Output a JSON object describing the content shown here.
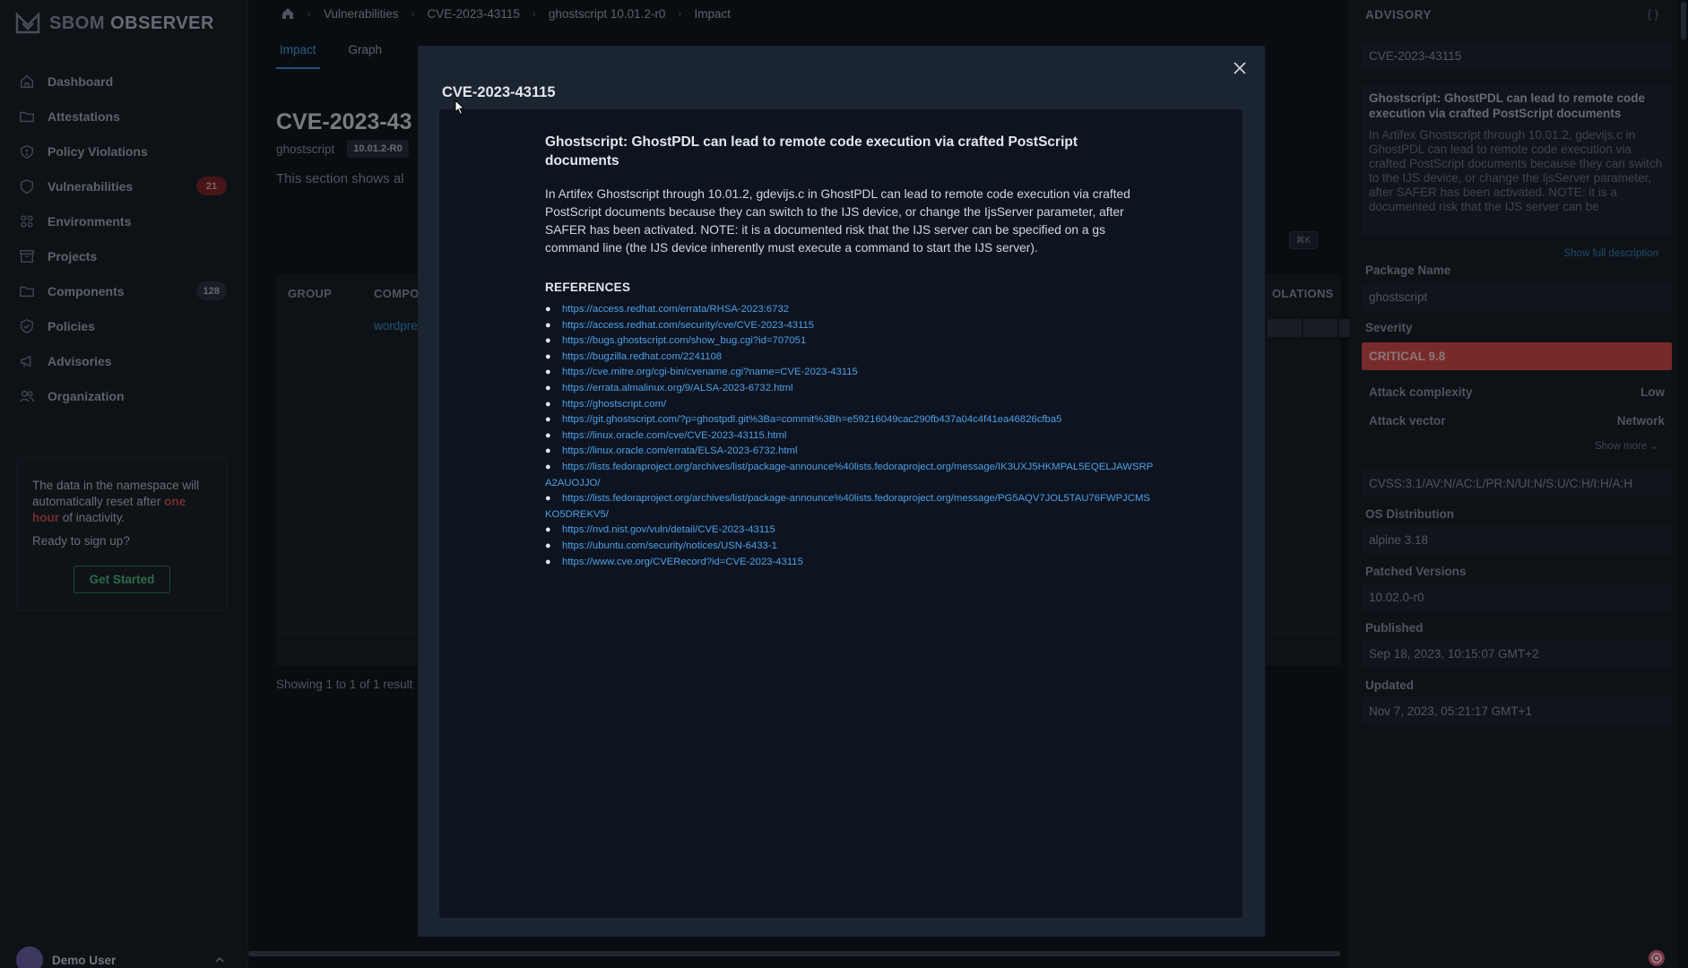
{
  "app": {
    "logo_light": "SBOM",
    "logo_bold": "OBSERVER"
  },
  "sidebar": {
    "items": [
      {
        "label": "Dashboard",
        "icon": "home-icon"
      },
      {
        "label": "Attestations",
        "icon": "folder-icon"
      },
      {
        "label": "Policy Violations",
        "icon": "alert-icon"
      },
      {
        "label": "Vulnerabilities",
        "icon": "shield-icon",
        "badge": "21"
      },
      {
        "label": "Environments",
        "icon": "grid-icon"
      },
      {
        "label": "Projects",
        "icon": "archive-icon"
      },
      {
        "label": "Components",
        "icon": "folder-icon",
        "badge": "128"
      },
      {
        "label": "Policies",
        "icon": "shield-check-icon"
      },
      {
        "label": "Advisories",
        "icon": "megaphone-icon"
      },
      {
        "label": "Organization",
        "icon": "users-icon"
      }
    ],
    "notice": {
      "text_1": "The data in the namespace will automatically reset after ",
      "highlight": "one hour",
      "text_2": " of inactivity.",
      "question": "Ready to sign up?",
      "button": "Get Started"
    },
    "user": "Demo User"
  },
  "breadcrumb": [
    "Vulnerabilities",
    "CVE-2023-43115",
    "ghostscript 10.01.2-r0",
    "Impact"
  ],
  "tabs": [
    "Impact",
    "Graph"
  ],
  "main": {
    "title": "CVE-2023-43",
    "package": "ghostscript",
    "version": "10.01.2-R0",
    "description": "This section shows al",
    "table": {
      "headers": [
        "GROUP",
        "COMPO",
        "OLATIONS"
      ],
      "cell": "wordpre",
      "kbd": "⌘K"
    },
    "showing": "Showing 1 to 1 of 1 result"
  },
  "advisory_panel": {
    "title": "ADVISORY",
    "braces": "{ }",
    "id": "CVE-2023-43115",
    "desc_title": "Ghostscript: GhostPDL can lead to remote code execution via crafted PostScript documents",
    "desc_text": "In Artifex Ghostscript through 10.01.2, gdevijs.c in GhostPDL can lead to remote code execution via crafted PostScript documents because they can switch to the IJS device, or change the IjsServer parameter, after SAFER has been activated. NOTE: it is a documented risk that the IJS server can be",
    "show_full": "Show full description",
    "package_label": "Package Name",
    "package_value": "ghostscript",
    "severity_label": "Severity",
    "severity_value": "CRITICAL 9.8",
    "severity_color": "#d84545",
    "attack_complexity_label": "Attack complexity",
    "attack_complexity_value": "Low",
    "attack_vector_label": "Attack vector",
    "attack_vector_value": "Network",
    "show_more": "Show more",
    "cvss": "CVSS:3.1/AV:N/AC:L/PR:N/UI:N/S:U/C:H/I:H/A:H",
    "os_label": "OS Distribution",
    "os_value": "alpine 3.18",
    "patched_label": "Patched Versions",
    "patched_value": "10.02.0-r0",
    "published_label": "Published",
    "published_value": "Sep 18, 2023, 10:15:07 GMT+2",
    "updated_label": "Updated",
    "updated_value": "Nov 7, 2023, 05:21:17 GMT+1"
  },
  "modal": {
    "title": "CVE-2023-43115",
    "advisory_title": "Ghostscript: GhostPDL can lead to remote code execution via crafted PostScript documents",
    "advisory_text": "In Artifex Ghostscript through 10.01.2, gdevijs.c in GhostPDL can lead to remote code execution via crafted PostScript documents because they can switch to the IJS device, or change the IjsServer parameter, after SAFER has been activated. NOTE: it is a documented risk that the IJS server can be specified on a gs command line (the IJS device inherently must execute a command to start the IJS server).",
    "references_heading": "REFERENCES",
    "references": [
      "https://access.redhat.com/errata/RHSA-2023:6732",
      "https://access.redhat.com/security/cve/CVE-2023-43115",
      "https://bugs.ghostscript.com/show_bug.cgi?id=707051",
      "https://bugzilla.redhat.com/2241108",
      "https://cve.mitre.org/cgi-bin/cvename.cgi?name=CVE-2023-43115",
      "https://errata.almalinux.org/9/ALSA-2023-6732.html",
      "https://ghostscript.com/",
      "https://git.ghostscript.com/?p=ghostpdl.git%3Ba=commit%3Bh=e59216049cac290fb437a04c4f41ea46826cfba5",
      "https://linux.oracle.com/cve/CVE-2023-43115.html",
      "https://linux.oracle.com/errata/ELSA-2023-6732.html",
      "https://lists.fedoraproject.org/archives/list/package-announce%40lists.fedoraproject.org/message/IK3UXJ5HKMPAL5EQELJAWSRPA2AUOJJO/",
      "https://lists.fedoraproject.org/archives/list/package-announce%40lists.fedoraproject.org/message/PG5AQV7JOL5TAU76FWPJCMSKO5DREKV5/",
      "https://nvd.nist.gov/vuln/detail/CVE-2023-43115",
      "https://ubuntu.com/security/notices/USN-6433-1",
      "https://www.cve.org/CVERecord?id=CVE-2023-43115"
    ]
  }
}
